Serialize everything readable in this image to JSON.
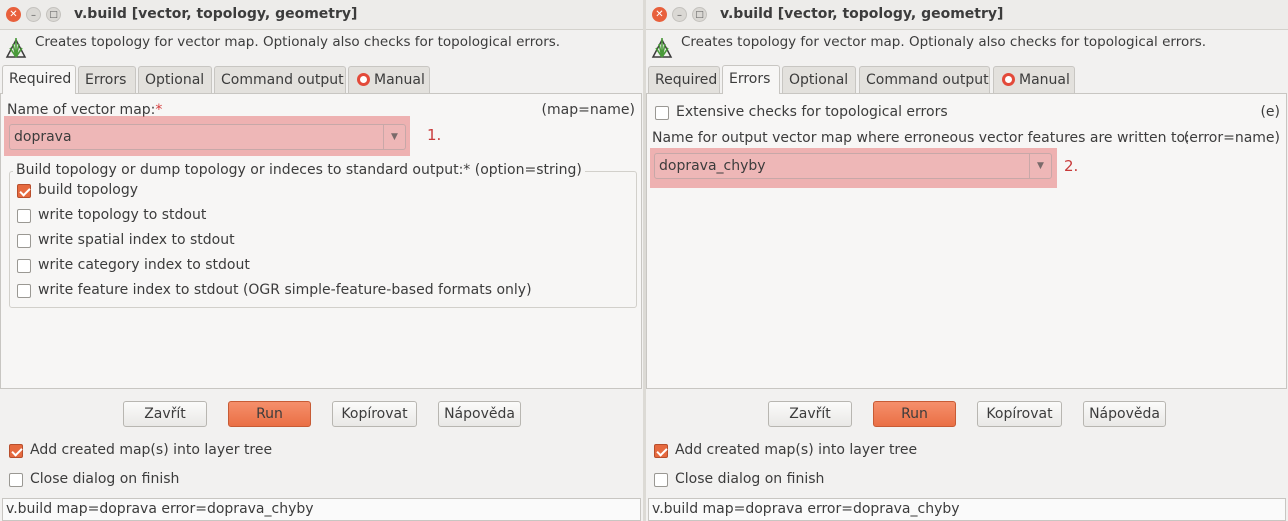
{
  "windows": [
    {
      "title": "v.build [vector, topology, geometry]",
      "description": "Creates topology for vector map. Optionaly also checks for topological errors.",
      "tabs": [
        "Required",
        "Errors",
        "Optional",
        "Command output",
        "Manual"
      ],
      "active_tab": "Required",
      "required": {
        "map_label": "Name of vector map:",
        "map_required_mark": "*",
        "map_param": "(map=name)",
        "map_value": "doprava",
        "step_marker": "1.",
        "option_group_title": "Build topology or dump topology or indeces to standard output:* (option=string)",
        "options": [
          {
            "label": "build topology",
            "checked": true
          },
          {
            "label": "write topology to stdout",
            "checked": false
          },
          {
            "label": "write spatial index to stdout",
            "checked": false
          },
          {
            "label": "write category index to stdout",
            "checked": false
          },
          {
            "label": "write feature index to stdout (OGR simple-feature-based formats only)",
            "checked": false
          }
        ]
      },
      "buttons": {
        "close": "Zavřít",
        "run": "Run",
        "copy": "Kopírovat",
        "help": "Nápověda"
      },
      "add_to_tree": {
        "label": "Add created map(s) into layer tree",
        "checked": true
      },
      "close_on_finish": {
        "label": "Close dialog on finish",
        "checked": false
      },
      "command": "v.build map=doprava error=doprava_chyby"
    },
    {
      "title": "v.build [vector, topology, geometry]",
      "description": "Creates topology for vector map. Optionaly also checks for topological errors.",
      "tabs": [
        "Required",
        "Errors",
        "Optional",
        "Command output",
        "Manual"
      ],
      "active_tab": "Errors",
      "errors": {
        "extensive_label": "Extensive checks for topological errors",
        "extensive_flag": "(e)",
        "extensive_checked": false,
        "output_label": "Name for output vector map where erroneous vector features are written to:",
        "output_param": "(error=name)",
        "output_value": "doprava_chyby",
        "step_marker": "2."
      },
      "buttons": {
        "close": "Zavřít",
        "run": "Run",
        "copy": "Kopírovat",
        "help": "Nápověda"
      },
      "add_to_tree": {
        "label": "Add created map(s) into layer tree",
        "checked": true
      },
      "close_on_finish": {
        "label": "Close dialog on finish",
        "checked": false
      },
      "command": "v.build map=doprava error=doprava_chyby"
    }
  ],
  "colors": {
    "accent": "#e66a3f",
    "highlight": "#e87878",
    "step_marker": "#c83a3a",
    "window_bg": "#f2f1f0"
  },
  "icons": {
    "close": "close-icon",
    "minimize": "minimize-icon",
    "maximize": "maximize-icon",
    "module": "grass-icon",
    "manual": "lifebuoy-icon",
    "dropdown": "chevron-down-icon"
  }
}
